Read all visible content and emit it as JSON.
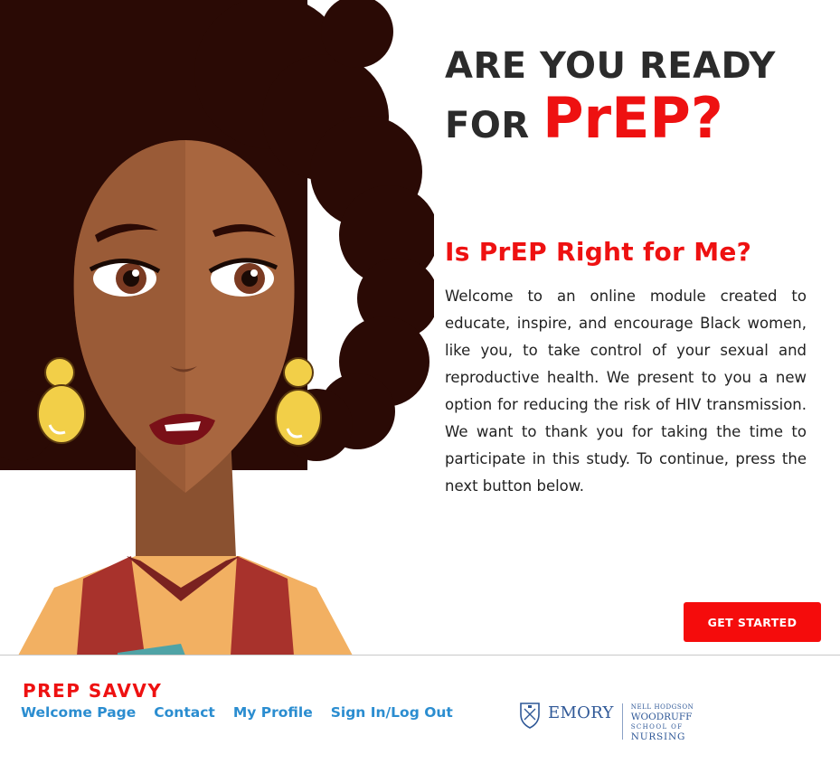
{
  "hero": {
    "title_line1": "ARE YOU READY",
    "title_line2_prefix": "FOR ",
    "title_line2_accent": "PrEP?"
  },
  "section": {
    "heading": "Is PrEP Right for Me?",
    "body": "Welcome to an online module created to educate, inspire, and encourage Black women, like you, to take control of your sexual and reproductive health. We present to you a new option for reducing the risk of HIV transmission. We want to thank you for taking the time to participate in this study. To continue, press the next button below."
  },
  "cta": {
    "label": "GET STARTED"
  },
  "footer": {
    "brand": "PREP SAVVY",
    "nav": [
      {
        "label": "Welcome Page"
      },
      {
        "label": "Contact"
      },
      {
        "label": "My Profile"
      },
      {
        "label": "Sign In/Log Out"
      }
    ],
    "logo": {
      "wordmark": "EMORY",
      "school_line1": "NELL HODGSON",
      "school_line2": "WOODRUFF",
      "school_line3": "SCHOOL OF",
      "school_line4": "NURSING"
    }
  },
  "colors": {
    "accent_red": "#ee1111",
    "heading_dark": "#2b2b2b",
    "nav_blue": "#2b8dd0",
    "emory_blue": "#2f5897"
  }
}
